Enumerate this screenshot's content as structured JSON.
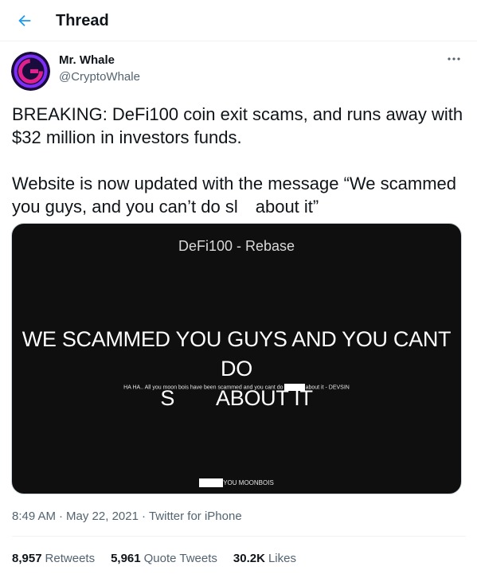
{
  "header": {
    "title": "Thread",
    "back_icon": "arrow-left-icon"
  },
  "colors": {
    "accent": "#1d9bf0",
    "text": "#0f1419",
    "muted": "#536471",
    "media_bg": "#0f0f10"
  },
  "author": {
    "name": "Mr. Whale",
    "handle": "@CryptoWhale",
    "more_icon": "more-horizontal-icon"
  },
  "tweet": {
    "paragraph1": "BREAKING: DeFi100 coin exit scams, and runs away with $32 million in investors funds.",
    "p2_before": "Website is now updated with the message “We scammed you guys, and you can’t do sl",
    "p2_after": "about it”"
  },
  "media": {
    "title": "DeFi100 - Rebase",
    "headline_line1": "WE SCAMMED YOU GUYS AND YOU CANT DO",
    "headline_s": "S",
    "headline_end": "ABOUT IT",
    "sub_before": "HA HA.. All you moon bois have been scammed and you cant do",
    "sub_after": "about it - DEVSIN",
    "footer": "YOU MOONBOIS"
  },
  "meta": {
    "time": "8:49 AM",
    "date": "May 22, 2021",
    "source": "Twitter for iPhone",
    "separator": "·"
  },
  "stats": [
    {
      "count": "8,957",
      "label": "Retweets"
    },
    {
      "count": "5,961",
      "label": "Quote Tweets"
    },
    {
      "count": "30.2K",
      "label": "Likes"
    }
  ]
}
